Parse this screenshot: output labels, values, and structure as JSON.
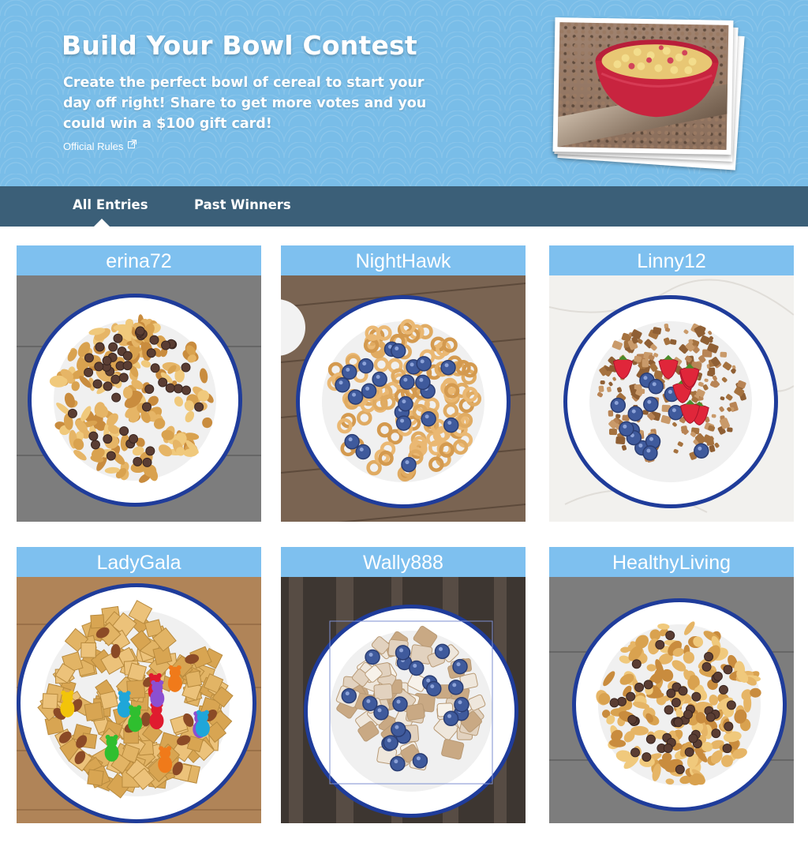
{
  "hero": {
    "title": "Build Your Bowl Contest",
    "description": "Create the perfect bowl of cereal to start your day off right! Share to get more votes and you could win a $100 gift card!",
    "rules_label": "Official Rules",
    "background_color": "#79bde8"
  },
  "tabs": [
    {
      "label": "All Entries",
      "active": true
    },
    {
      "label": "Past Winners",
      "active": false
    }
  ],
  "entries": [
    {
      "username": "erina72",
      "background": "gray-wood",
      "cereal": "flakes",
      "toppings": "chocolate-chips"
    },
    {
      "username": "NightHawk",
      "background": "brown-wood",
      "cereal": "oat-rings",
      "toppings": "blueberries"
    },
    {
      "username": "Linny12",
      "background": "marble",
      "cereal": "granola",
      "toppings": "blueberries-strawberries"
    },
    {
      "username": "LadyGala",
      "background": "light-wood",
      "cereal": "wheat-squares",
      "toppings": "gummy-bears-pecans"
    },
    {
      "username": "Wally888",
      "background": "dark-wood",
      "cereal": "frosted-shredded-wheat",
      "toppings": "blueberries"
    },
    {
      "username": "HealthyLiving",
      "background": "gray-wood",
      "cereal": "flakes",
      "toppings": "chocolate-chips"
    }
  ],
  "colors": {
    "card_header": "#7ec0ef",
    "tab_bar": "#3b5f78",
    "bowl_rim": "#1f3c9a"
  }
}
